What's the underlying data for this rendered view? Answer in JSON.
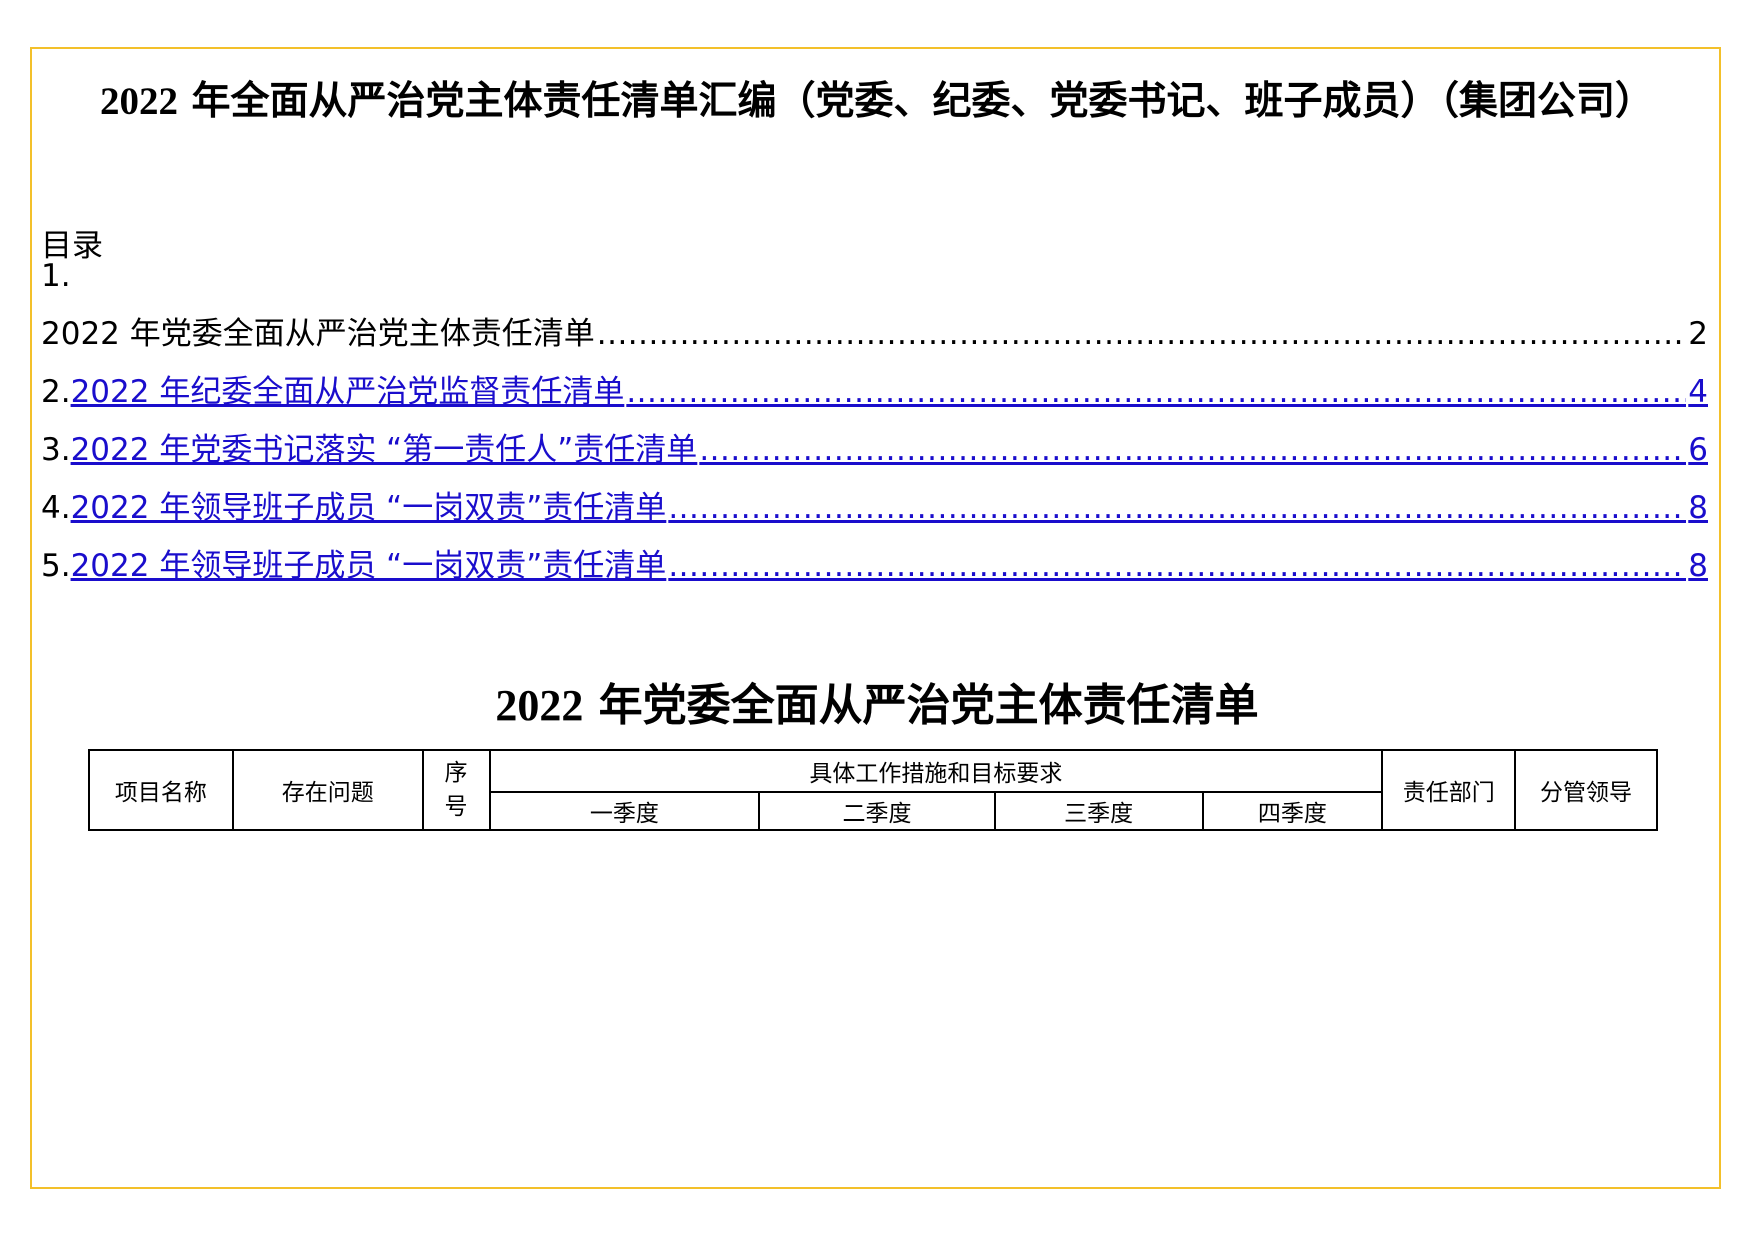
{
  "document": {
    "title_year": "2022",
    "title_rest": " 年全面从严治党主体责任清单汇编（党委、纪委、党委书记、班子成员）（集团公司）"
  },
  "toc": {
    "heading": "目录",
    "items": [
      {
        "number": "1.",
        "text": "2022 年党委全面从严治党主体责任清单",
        "page": "2",
        "is_link": false
      },
      {
        "number": "2.",
        "text": "2022 年纪委全面从严治党监督责任清单",
        "page": "4",
        "is_link": true
      },
      {
        "number": "3.",
        "text": "2022 年党委书记落实 “第一责任人”责任清单",
        "page": "6",
        "is_link": true
      },
      {
        "number": "4.",
        "text": "2022 年领导班子成员 “一岗双责”责任清单",
        "page": "8",
        "is_link": true
      },
      {
        "number": "5.",
        "text": "2022 年领导班子成员 “一岗双责”责任清单",
        "page": "8",
        "is_link": true
      }
    ]
  },
  "section": {
    "title_year": "2022",
    "title_rest": " 年党委全面从严治党主体责任清单"
  },
  "table": {
    "headers": {
      "project": "项目名称",
      "problem": "存在问题",
      "seq": "序号",
      "measures": "具体工作措施和目标要求",
      "dept": "责任部门",
      "leader": "分管领导"
    },
    "quarters": [
      "一季度",
      "二季度",
      "三季度",
      "四季度"
    ]
  },
  "colors": {
    "frame": "#f3c02a",
    "link": "#1a0dcc"
  }
}
